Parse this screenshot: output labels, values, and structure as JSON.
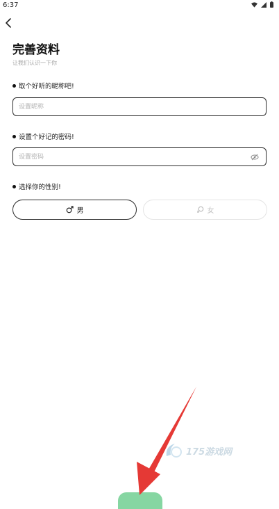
{
  "status_bar": {
    "time": "6:37",
    "icons": [
      "wifi-icon",
      "signal-icon",
      "battery-icon"
    ]
  },
  "header": {
    "back_icon": "chevron-left-icon",
    "title": "完善资料",
    "subtitle": "让我们认识一下你"
  },
  "form": {
    "nickname": {
      "label": "取个好听的昵称吧!",
      "placeholder": "设置昵称",
      "value": ""
    },
    "password": {
      "label": "设置个好记的密码!",
      "placeholder": "设置密码",
      "value": "",
      "toggle_icon": "eye-off-icon"
    },
    "gender": {
      "label": "选择你的性别!",
      "options": [
        {
          "label": "男",
          "icon": "male-icon",
          "selected": true
        },
        {
          "label": "女",
          "icon": "female-icon",
          "selected": false
        }
      ]
    }
  },
  "footer": {
    "next_button_color": "#86d6a2"
  },
  "watermark": {
    "text": "175游戏网"
  },
  "colors": {
    "accent_green": "#86d6a2",
    "annotation_arrow": "#e53935",
    "text_primary": "#111111",
    "text_muted": "#a6a6a6"
  }
}
